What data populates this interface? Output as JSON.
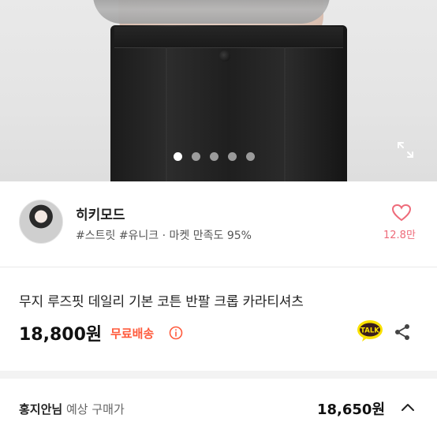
{
  "gallery": {
    "image_count": 5,
    "active_index": 0
  },
  "seller": {
    "name": "히키모드",
    "tags": "#스트릿 #유니크 · 마켓 만족도 95%",
    "likes": "12.8만"
  },
  "product": {
    "title": "무지 루즈핏 데일리 기본 코튼 반팔 크롭 카라티셔츠",
    "price": "18,800원",
    "shipping": "무료배송"
  },
  "expected": {
    "user": "홍지안님",
    "label": "예상 구매가",
    "price": "18,650원"
  },
  "colors": {
    "accent": "#ff5a3c",
    "like": "#ee6b7a"
  }
}
